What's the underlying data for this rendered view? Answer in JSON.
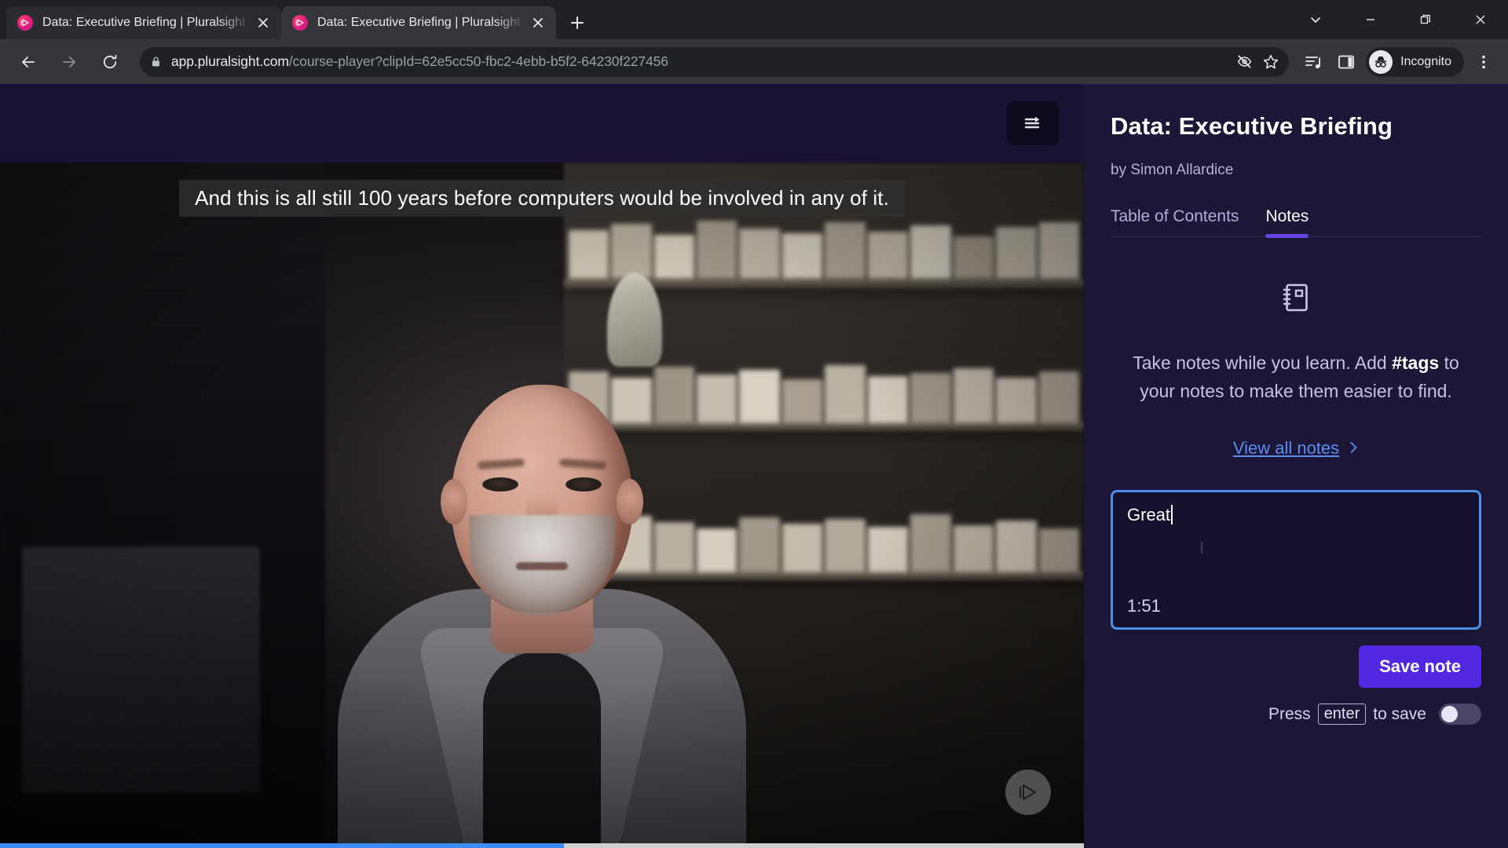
{
  "browser": {
    "tabs": [
      {
        "title": "Data: Executive Briefing | Pluralsight",
        "favicon": "pluralsight-icon",
        "active": false
      },
      {
        "title": "Data: Executive Briefing | Pluralsight",
        "favicon": "pluralsight-icon",
        "active": true
      }
    ],
    "new_tab_label": "+",
    "window_controls": [
      "tab-search-chevron-icon",
      "minimize-icon",
      "maximize-icon",
      "close-icon"
    ],
    "nav": {
      "back": "back-arrow-icon",
      "forward": "forward-arrow-icon",
      "reload": "reload-icon"
    },
    "omnibox": {
      "lock": "lock-icon",
      "host": "app.pluralsight.com",
      "path": "/course-player?clipId=62e5cc50-fbc2-4ebb-b5f2-64230f227456",
      "full_url": "app.pluralsight.com/course-player?clipId=62e5cc50-fbc2-4ebb-b5f2-64230f227456",
      "icons": [
        "eye-slash-icon",
        "star-bookmark-icon"
      ]
    },
    "toolbar_icons": [
      "media-playlist-icon",
      "side-panel-icon"
    ],
    "profile": {
      "label": "Incognito",
      "avatar": "incognito-hat-glasses-icon"
    },
    "menu_icon": "three-dot-menu-icon"
  },
  "player": {
    "playlist_button_icon": "playlist-collapse-icon",
    "caption": "And this is all still 100 years before computers would be involved in any of it.",
    "watermark_icon": "pluralsight-play-icon",
    "progress_percent": 52
  },
  "sidebar": {
    "title": "Data: Executive Briefing",
    "author": "by Simon Allardice",
    "tabs": [
      {
        "label": "Table of Contents",
        "active": false
      },
      {
        "label": "Notes",
        "active": true
      }
    ],
    "empty_state": {
      "icon": "notebook-icon",
      "text_before": "Take notes while you learn. Add ",
      "tags_word": "#tags",
      "text_after": " to your notes to make them easier to find.",
      "view_all_label": "View all notes",
      "view_all_chevron": "chevron-right-icon"
    },
    "note_editor": {
      "value": "Great",
      "timestamp": "1:51",
      "caret_visible": true
    },
    "save_button": "Save note",
    "press_enter": {
      "prefix": "Press",
      "key": "enter",
      "suffix": "to save",
      "toggle_on": false
    }
  },
  "colors": {
    "accent_purple": "#5127e0",
    "tab_underline": "#6642e0",
    "link_blue": "#5d8df5",
    "focus_border": "#4a90e8",
    "progress_blue": "#3d8bf2",
    "sidebar_bg": "#1c1637"
  }
}
